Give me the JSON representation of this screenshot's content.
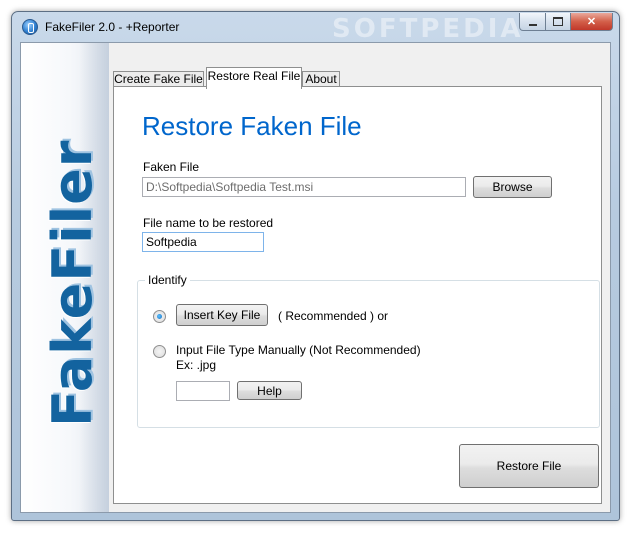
{
  "window": {
    "title": "FakeFiler 2.0 - +Reporter",
    "watermark": "SOFTPEDIA",
    "controls": {
      "minimize": "minimize-icon",
      "maximize": "maximize-icon",
      "close": "close-icon",
      "close_glyph": "✕"
    }
  },
  "banner": {
    "logo_text": "FakeFiler"
  },
  "tabs": [
    {
      "label": "Create Fake File",
      "active": false
    },
    {
      "label": "Restore Real File",
      "active": true
    },
    {
      "label": "About",
      "active": false
    }
  ],
  "restore": {
    "heading": "Restore Faken File",
    "faken_file_label": "Faken File",
    "faken_file_value": "D:\\Softpedia\\Softpedia Test.msi",
    "browse_label": "Browse",
    "restore_name_label": "File name to be restored",
    "restore_name_value": "Softpedia",
    "identify": {
      "label": "Identify",
      "option_key": {
        "selected": true,
        "button_label": "Insert Key File",
        "note": "( Recommended )  or"
      },
      "option_manual": {
        "selected": false,
        "label": "Input File Type Manually (Not Recommended)",
        "example": "Ex: .jpg",
        "value": "",
        "help_label": "Help"
      }
    },
    "restore_button_label": "Restore File"
  },
  "colors": {
    "heading": "#0066cc",
    "logo": "#13639f",
    "window_frame": "#b7cbe0"
  }
}
